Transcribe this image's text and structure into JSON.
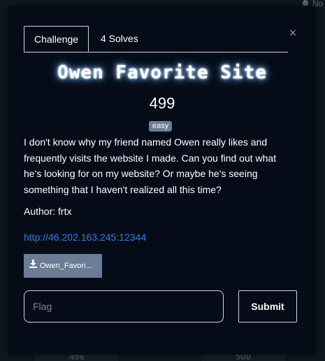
{
  "background": {
    "nav_text": "No",
    "card_values": [
      "456",
      "500"
    ]
  },
  "modal": {
    "tabs": [
      {
        "label": "Challenge",
        "active": true
      },
      {
        "label": "4 Solves",
        "active": false
      }
    ],
    "close_symbol": "×",
    "title": "Owen Favorite Site",
    "points": "499",
    "difficulty": "easy",
    "description": "I don't know why my friend named Owen really likes and frequently visits the website I made. Can you find out what he's looking for on my website? Or maybe he's seeing something that I haven't realized all this time?",
    "author": "Author: frtx",
    "link": "http://46.202.163.245:12344",
    "file_label": "Owen_Favori...",
    "flag_placeholder": "Flag",
    "flag_value": "",
    "submit_label": "Submit"
  },
  "icons": {
    "download": "download-icon",
    "close": "close-icon",
    "user": "user-icon"
  },
  "colors": {
    "modal_bg": "#050c18",
    "badge_bg": "#6b7d96",
    "link": "#2f7fe6"
  }
}
